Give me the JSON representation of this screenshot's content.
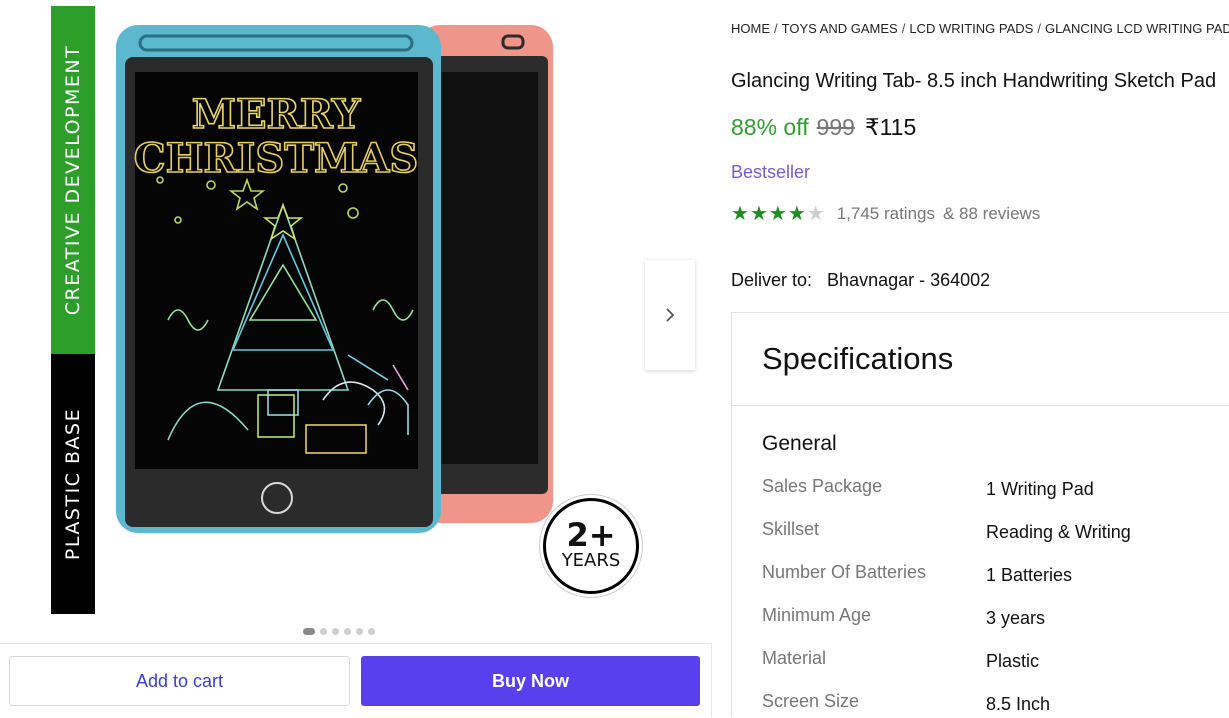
{
  "gallery": {
    "band_top": "CREATIVE  DEVELOPMENT",
    "band_bottom": "PLASTIC  BASE",
    "screen_text_line1": "MERRY",
    "screen_text_line2": "CHRISTMAS",
    "age_badge_number": "2+",
    "age_badge_text": "YEARS",
    "dots_total": 6,
    "dots_active_index": 0
  },
  "actions": {
    "add_to_cart": "Add to cart",
    "buy_now": "Buy Now"
  },
  "breadcrumb": [
    "HOME",
    "TOYS AND GAMES",
    "LCD WRITING PADS",
    "GLANCING LCD WRITING PADS"
  ],
  "breadcrumb_separator": "/",
  "product": {
    "title": "Glancing Writing Tab- 8.5 inch Handwriting Sketch Pad",
    "discount": "88% off",
    "mrp": "999",
    "price": "₹115",
    "badge": "Bestseller",
    "rating_stars": 4,
    "rating_max": 5,
    "ratings": "1,745 ratings",
    "reviews": "& 88 reviews"
  },
  "delivery": {
    "label": "Deliver to:",
    "location": "Bhavnagar - 364002"
  },
  "specifications": {
    "title": "Specifications",
    "group": "General",
    "rows": [
      {
        "key": "Sales Package",
        "value": "1 Writing Pad"
      },
      {
        "key": "Skillset",
        "value": "Reading & Writing"
      },
      {
        "key": "Number Of Batteries",
        "value": "1 Batteries"
      },
      {
        "key": "Minimum Age",
        "value": "3 years"
      },
      {
        "key": "Material",
        "value": "Plastic"
      },
      {
        "key": "Screen Size",
        "value": "8.5 Inch"
      }
    ]
  },
  "colors": {
    "accent_green": "#2f9d2f",
    "buy_button": "#5a3fef",
    "bestseller": "#7b5ad0",
    "band_green": "#2e9e2a",
    "tablet_blue": "#5bb8cf",
    "tablet_pink": "#f0958a"
  },
  "icons": {
    "next": "chevron-right-icon",
    "star": "star-icon"
  }
}
